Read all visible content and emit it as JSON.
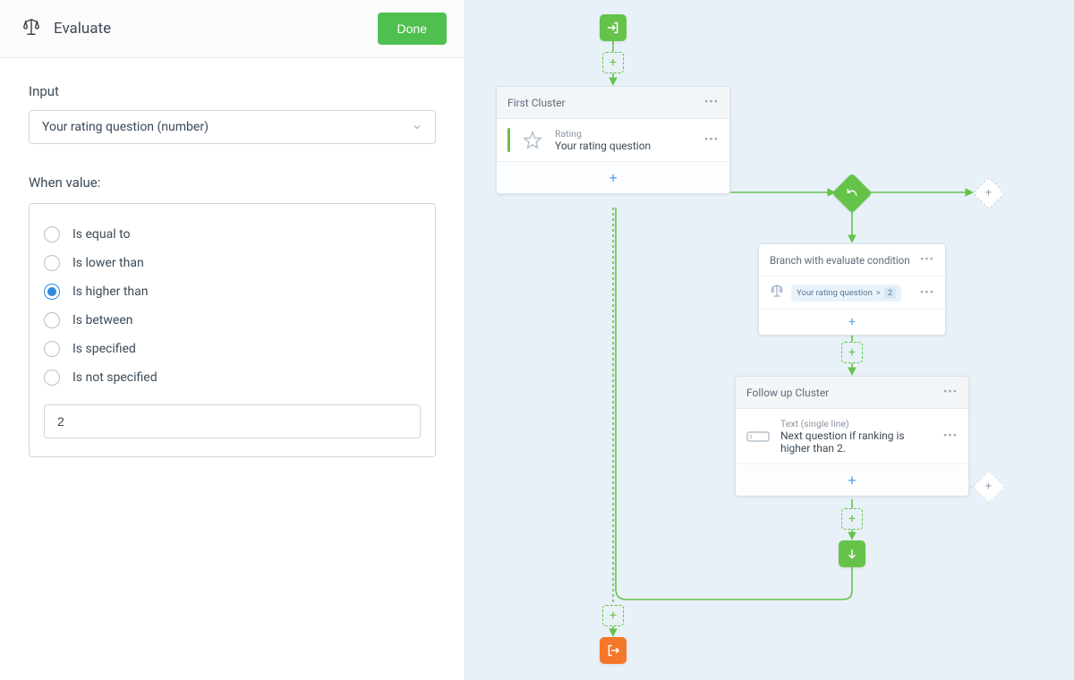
{
  "panel": {
    "title": "Evaluate",
    "done_label": "Done",
    "input_label": "Input",
    "input_value": "Your rating question (number)",
    "when_label": "When value:",
    "options": [
      {
        "label": "Is equal to",
        "selected": false
      },
      {
        "label": "Is lower than",
        "selected": false
      },
      {
        "label": "Is higher than",
        "selected": true
      },
      {
        "label": "Is between",
        "selected": false
      },
      {
        "label": "Is specified",
        "selected": false
      },
      {
        "label": "Is not specified",
        "selected": false
      }
    ],
    "value_input": "2"
  },
  "flow": {
    "cluster1": {
      "title": "First Cluster",
      "question_type": "Rating",
      "question_title": "Your rating question"
    },
    "branch": {
      "title": "Branch with evaluate condition",
      "cond_field": "Your rating question",
      "cond_op": ">",
      "cond_value": "2"
    },
    "cluster2": {
      "title": "Follow up Cluster",
      "question_type": "Text (single line)",
      "question_title": "Next question if ranking is higher than 2."
    }
  },
  "colors": {
    "accent_green": "#66c34a",
    "accent_blue": "#2f8ae0",
    "accent_orange": "#f5782a"
  }
}
